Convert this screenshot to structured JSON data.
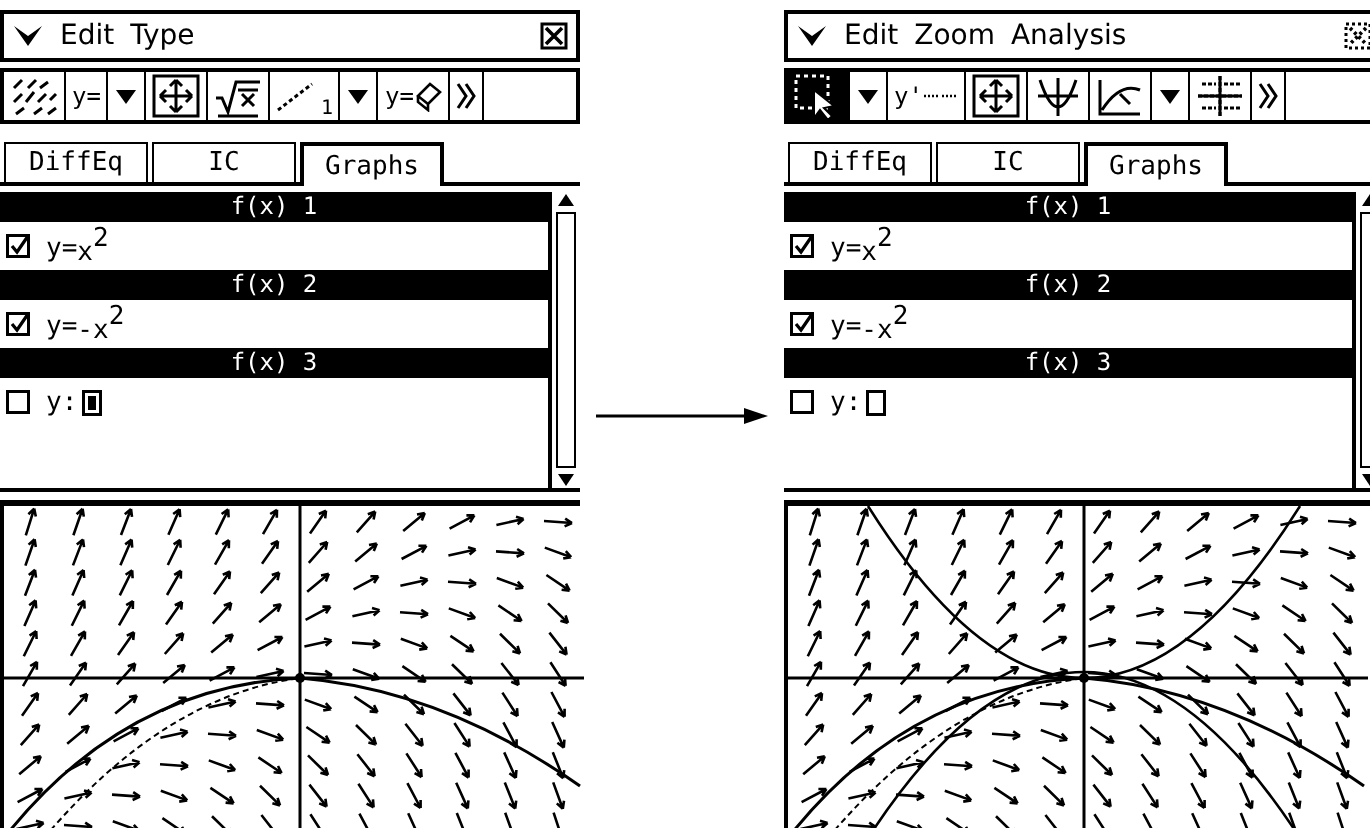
{
  "screens": [
    {
      "menu_items": [
        "Edit",
        "Type"
      ],
      "close_disabled": false,
      "toolbar": [
        {
          "kind": "slope-field",
          "selected": false
        },
        {
          "kind": "label",
          "label": "y=",
          "selected": false
        },
        {
          "kind": "dropdown",
          "selected": false
        },
        {
          "kind": "arrows",
          "selected": false
        },
        {
          "kind": "formula",
          "selected": false
        },
        {
          "kind": "line",
          "label": "1",
          "selected": false
        },
        {
          "kind": "dropdown",
          "selected": false
        },
        {
          "kind": "label-eraser",
          "label": "y=",
          "selected": false
        },
        {
          "kind": "more",
          "selected": false
        }
      ],
      "tabs": [
        {
          "label": "DiffEq",
          "selected": false
        },
        {
          "label": "IC",
          "selected": false
        },
        {
          "label": "Graphs",
          "selected": true
        }
      ],
      "functions": [
        {
          "header": "f(x) 1",
          "checked": true,
          "expression": "y=$_{x}$$^{2}$"
        },
        {
          "header": "f(x) 2",
          "checked": true,
          "expression": "y=$_{-x}$$^{2}$"
        },
        {
          "header": "f(x) 3",
          "checked": false,
          "expression": "y:",
          "cursor_active": true
        }
      ],
      "graph": {
        "functions_plotted": false
      }
    },
    {
      "menu_items": [
        "Edit",
        "Zoom",
        "Analysis"
      ],
      "close_disabled": true,
      "toolbar": [
        {
          "kind": "pointer",
          "selected": true
        },
        {
          "kind": "dropdown",
          "selected": false
        },
        {
          "kind": "label-dots",
          "label": "y'",
          "selected": false
        },
        {
          "kind": "arrows",
          "selected": false
        },
        {
          "kind": "trace",
          "selected": false
        },
        {
          "kind": "sketch",
          "selected": false
        },
        {
          "kind": "dropdown",
          "selected": false
        },
        {
          "kind": "grid",
          "selected": false
        },
        {
          "kind": "more",
          "selected": false
        }
      ],
      "tabs": [
        {
          "label": "DiffEq",
          "selected": false
        },
        {
          "label": "IC",
          "selected": false
        },
        {
          "label": "Graphs",
          "selected": true
        }
      ],
      "functions": [
        {
          "header": "f(x) 1",
          "checked": true,
          "expression": "y=$_{x}$$^{2}$"
        },
        {
          "header": "f(x) 2",
          "checked": true,
          "expression": "y=$_{-x}$$^{2}$"
        },
        {
          "header": "f(x) 3",
          "checked": false,
          "expression": "y:",
          "cursor_active": false
        }
      ],
      "graph": {
        "functions_plotted": true
      }
    }
  ]
}
